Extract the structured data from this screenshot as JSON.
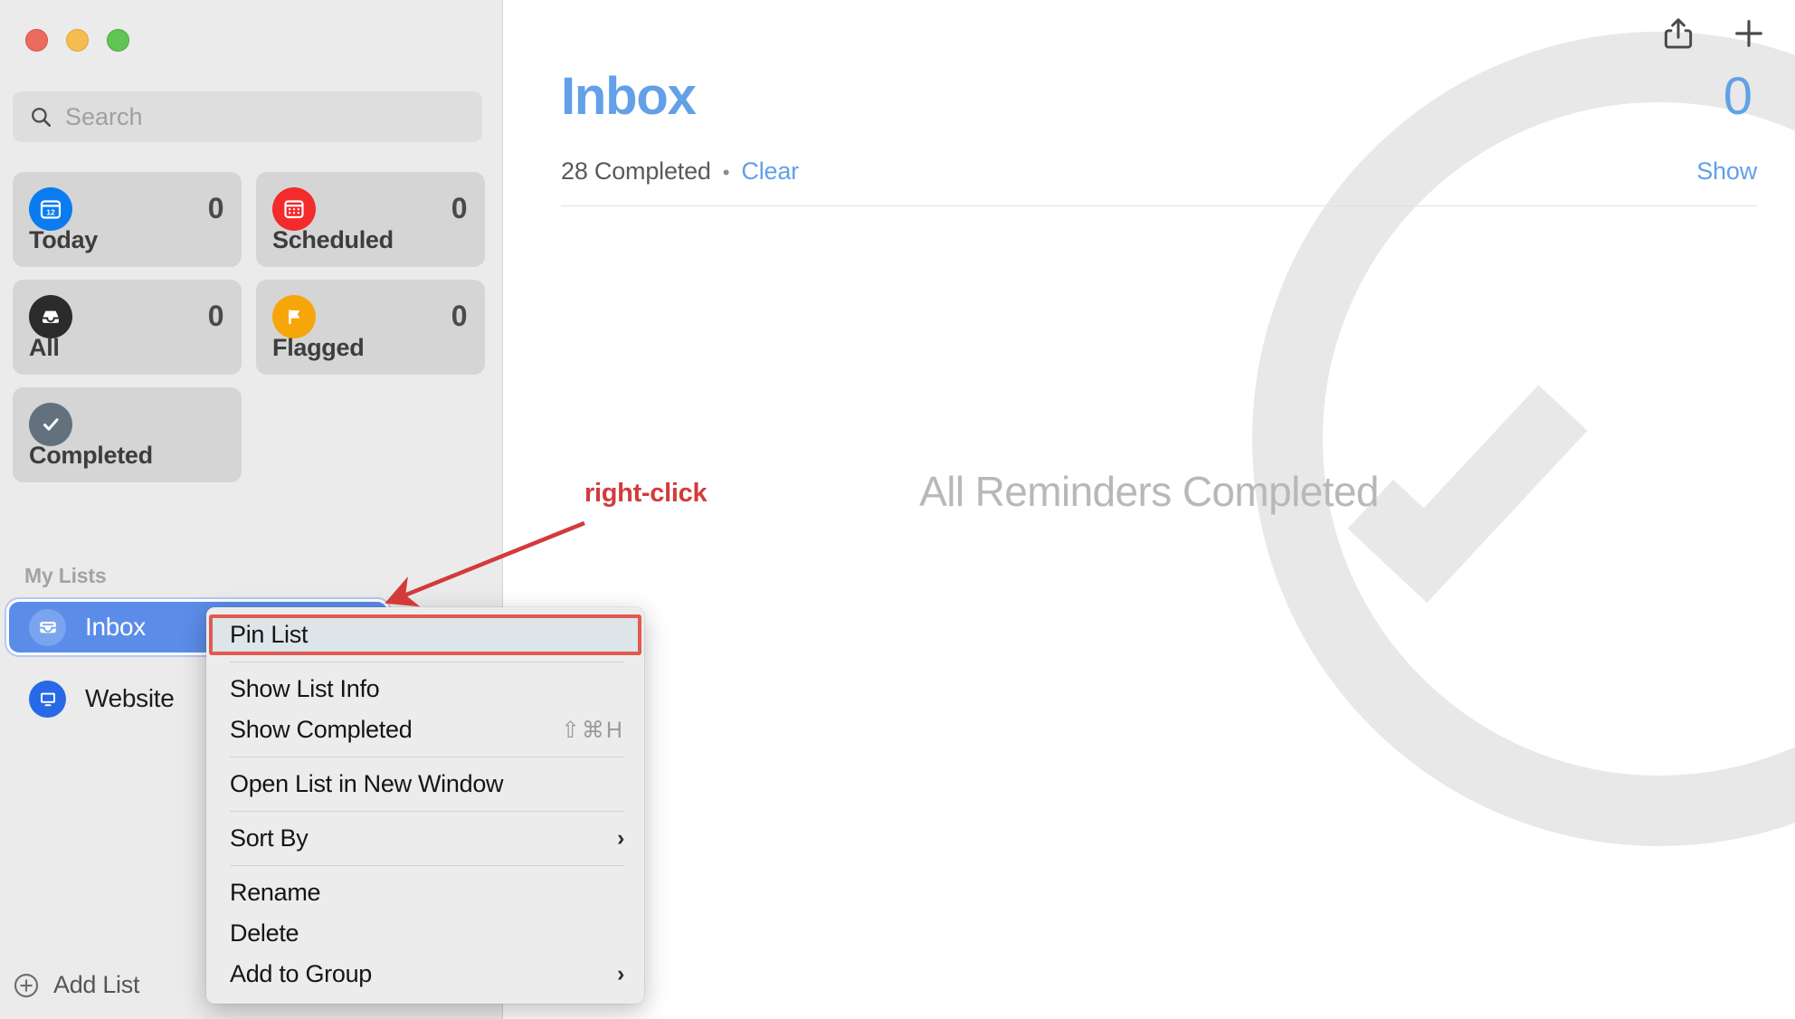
{
  "window": {
    "traffic_lights": [
      "close",
      "minimize",
      "zoom"
    ]
  },
  "sidebar": {
    "search": {
      "placeholder": "Search",
      "value": "",
      "icon": "search-icon"
    },
    "smart_cards": [
      {
        "label": "Today",
        "count": "0",
        "icon": "calendar-today-icon",
        "icon_text": "12",
        "color": "#0a7cf0"
      },
      {
        "label": "Scheduled",
        "count": "0",
        "icon": "calendar-icon",
        "color": "#f42b2b"
      },
      {
        "label": "All",
        "count": "0",
        "icon": "inbox-tray-icon",
        "color": "#2b2b2b"
      },
      {
        "label": "Flagged",
        "count": "0",
        "icon": "flag-icon",
        "color": "#f6a609"
      },
      {
        "label": "Completed",
        "count": "",
        "icon": "checkmark-icon",
        "color": "#63717e"
      }
    ],
    "section_header": "My Lists",
    "lists": [
      {
        "label": "Inbox",
        "icon": "inbox-icon",
        "selected": true,
        "color": "#7aa4ee"
      },
      {
        "label": "Website",
        "icon": "monitor-icon",
        "selected": false,
        "color": "#2869e8"
      }
    ],
    "add_list": {
      "label": "Add List",
      "icon": "plus-circle-icon"
    }
  },
  "toolbar": {
    "share": {
      "icon": "share-icon"
    },
    "add": {
      "icon": "plus-icon"
    }
  },
  "main": {
    "title": "Inbox",
    "count": "0",
    "completed_text": "28 Completed",
    "separator": "•",
    "clear_label": "Clear",
    "show_label": "Show",
    "empty_state": "All Reminders Completed"
  },
  "annotation": {
    "label": "right-click",
    "color": "#d33b3b"
  },
  "context_menu": {
    "items": [
      {
        "label": "Pin List",
        "shortcut": "",
        "submenu": false,
        "highlighted": true
      },
      {
        "type": "separator"
      },
      {
        "label": "Show List Info",
        "shortcut": "",
        "submenu": false,
        "highlighted": false
      },
      {
        "label": "Show Completed",
        "shortcut": "⇧⌘H",
        "submenu": false,
        "highlighted": false
      },
      {
        "type": "separator"
      },
      {
        "label": "Open List in New Window",
        "shortcut": "",
        "submenu": false,
        "highlighted": false
      },
      {
        "type": "separator"
      },
      {
        "label": "Sort By",
        "shortcut": "",
        "submenu": true,
        "highlighted": false
      },
      {
        "type": "separator"
      },
      {
        "label": "Rename",
        "shortcut": "",
        "submenu": false,
        "highlighted": false
      },
      {
        "label": "Delete",
        "shortcut": "",
        "submenu": false,
        "highlighted": false
      },
      {
        "label": "Add to Group",
        "shortcut": "",
        "submenu": true,
        "highlighted": false
      }
    ],
    "submenu_arrow": "›"
  }
}
